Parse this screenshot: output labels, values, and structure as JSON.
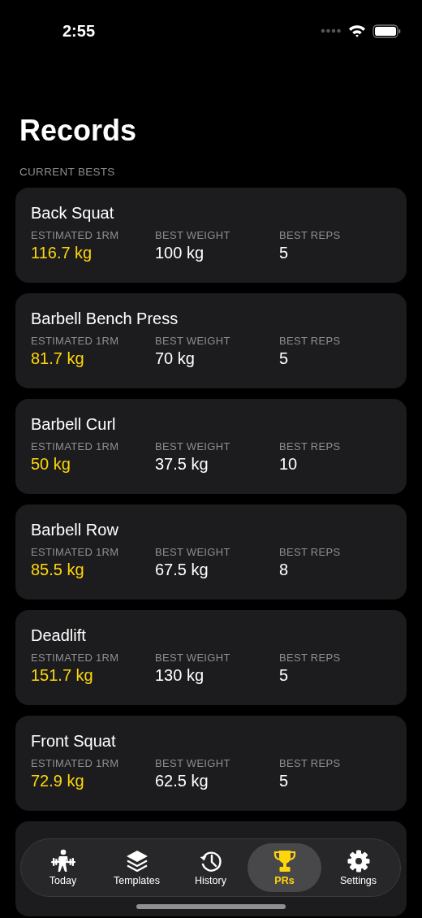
{
  "status_bar": {
    "time": "2:55"
  },
  "title": "Records",
  "section_header": "CURRENT BESTS",
  "records": [
    {
      "exercise": "Back Squat",
      "metrics": [
        {
          "label": "ESTIMATED 1RM",
          "value": "116.7 kg",
          "highlight": true
        },
        {
          "label": "BEST WEIGHT",
          "value": "100 kg",
          "highlight": false
        },
        {
          "label": "BEST REPS",
          "value": "5",
          "highlight": false
        }
      ]
    },
    {
      "exercise": "Barbell Bench Press",
      "metrics": [
        {
          "label": "ESTIMATED 1RM",
          "value": "81.7 kg",
          "highlight": true
        },
        {
          "label": "BEST WEIGHT",
          "value": "70 kg",
          "highlight": false
        },
        {
          "label": "BEST REPS",
          "value": "5",
          "highlight": false
        }
      ]
    },
    {
      "exercise": "Barbell Curl",
      "metrics": [
        {
          "label": "ESTIMATED 1RM",
          "value": "50 kg",
          "highlight": true
        },
        {
          "label": "BEST WEIGHT",
          "value": "37.5 kg",
          "highlight": false
        },
        {
          "label": "BEST REPS",
          "value": "10",
          "highlight": false
        }
      ]
    },
    {
      "exercise": "Barbell Row",
      "metrics": [
        {
          "label": "ESTIMATED 1RM",
          "value": "85.5 kg",
          "highlight": true
        },
        {
          "label": "BEST WEIGHT",
          "value": "67.5 kg",
          "highlight": false
        },
        {
          "label": "BEST REPS",
          "value": "8",
          "highlight": false
        }
      ]
    },
    {
      "exercise": "Deadlift",
      "metrics": [
        {
          "label": "ESTIMATED 1RM",
          "value": "151.7 kg",
          "highlight": true
        },
        {
          "label": "BEST WEIGHT",
          "value": "130 kg",
          "highlight": false
        },
        {
          "label": "BEST REPS",
          "value": "5",
          "highlight": false
        }
      ]
    },
    {
      "exercise": "Front Squat",
      "metrics": [
        {
          "label": "ESTIMATED 1RM",
          "value": "72.9 kg",
          "highlight": true
        },
        {
          "label": "BEST WEIGHT",
          "value": "62.5 kg",
          "highlight": false
        },
        {
          "label": "BEST REPS",
          "value": "5",
          "highlight": false
        }
      ]
    }
  ],
  "tabs": [
    {
      "label": "Today",
      "selected": false
    },
    {
      "label": "Templates",
      "selected": false
    },
    {
      "label": "History",
      "selected": false
    },
    {
      "label": "PRs",
      "selected": true
    },
    {
      "label": "Settings",
      "selected": false
    }
  ]
}
